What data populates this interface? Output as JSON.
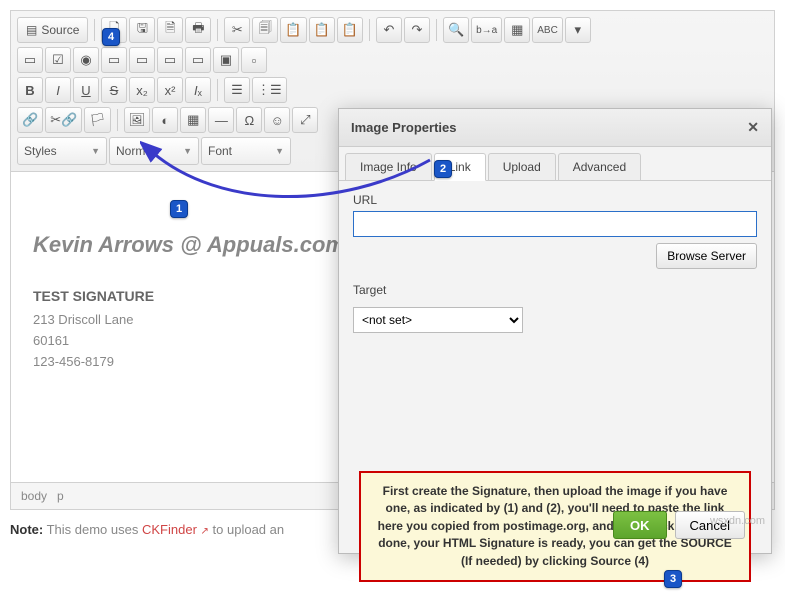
{
  "toolbar": {
    "source_label": "Source"
  },
  "dropdowns": {
    "styles": "Styles",
    "format": "Normal",
    "font": "Font"
  },
  "signature": {
    "title_line": "Kevin Arrows @ Appuals.com",
    "name": "TEST SIGNATURE",
    "line1": "213 Driscoll Lane",
    "line2": "60161",
    "line3": "123-456-8179"
  },
  "statusbar": {
    "path1": "body",
    "path2": "p"
  },
  "note": {
    "prefix": "Note:",
    "text1": " This demo uses ",
    "link": "CKFinder",
    "text2": " to upload an"
  },
  "dialog": {
    "title": "Image Properties",
    "tabs": {
      "info": "Image Info",
      "link": "Link",
      "upload": "Upload",
      "advanced": "Advanced"
    },
    "url_label": "URL",
    "url_value": "",
    "browse": "Browse Server",
    "target_label": "Target",
    "target_value": "<not set>",
    "ok": "OK",
    "cancel": "Cancel"
  },
  "instruction": "First create the Signature, then upload the image if you have one, as indicated by (1) and (2), you'll need to paste the link here you copied from postimage.org, and then Click OK. Once done, your HTML Signature is ready, you can get the SOURCE (If needed) by clicking Source (4)",
  "badges": {
    "b1": "1",
    "b2": "2",
    "b3": "3",
    "b4": "4"
  },
  "watermark": "wsxdn.com"
}
